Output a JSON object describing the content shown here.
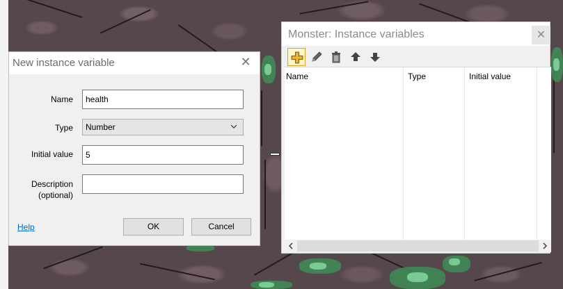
{
  "new_variable_dialog": {
    "title": "New instance variable",
    "close_glyph": "✕",
    "name_label": "Name",
    "name_value": "health",
    "type_label": "Type",
    "type_value": "Number",
    "initial_label": "Initial value",
    "initial_value": "5",
    "description_label_1": "Description",
    "description_label_2": "(optional)",
    "description_value": "",
    "help_link": "Help",
    "ok_label": "OK",
    "cancel_label": "Cancel"
  },
  "instance_variables_dialog": {
    "title": "Monster: Instance variables",
    "close_glyph": "✕",
    "toolbar": [
      "add-icon",
      "edit-pencil-icon",
      "delete-trash-icon",
      "move-up-icon",
      "move-down-icon"
    ],
    "columns": [
      "Name",
      "Type",
      "Initial value"
    ],
    "rows": []
  },
  "colors": {
    "accent_yellow": "#d7a81e",
    "link_blue": "#0066cc",
    "rock": "#5b4b52",
    "moss": "#3f8a55"
  }
}
